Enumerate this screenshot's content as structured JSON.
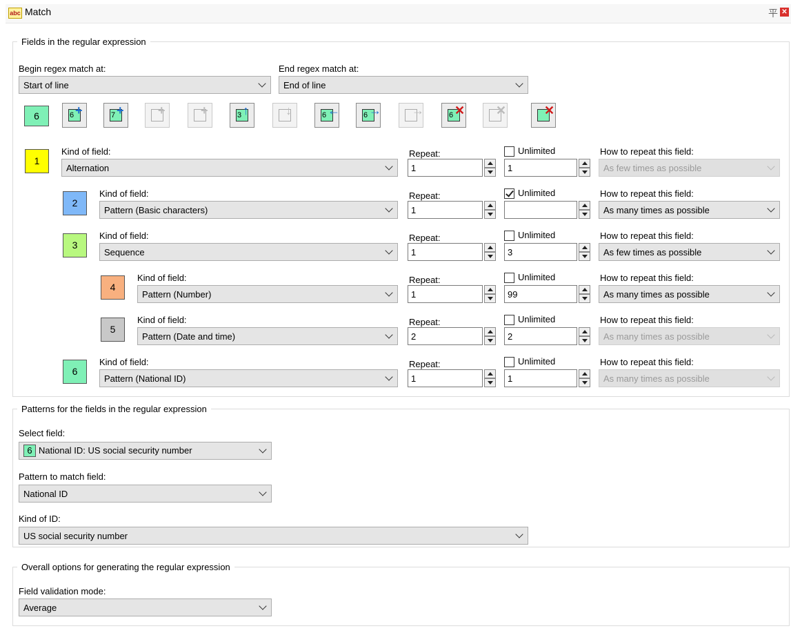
{
  "window": {
    "title": "Match",
    "title_icon_text": "abc"
  },
  "groups": {
    "fields": "Fields in the regular expression",
    "patterns": "Patterns for the fields in the regular expression",
    "overall": "Overall options for generating the regular expression"
  },
  "begin": {
    "label": "Begin regex match at:",
    "value": "Start of line"
  },
  "end": {
    "label": "End regex match at:",
    "value": "End of line"
  },
  "toolbar": {
    "counter": "6",
    "buttons": [
      {
        "name": "add-field-button",
        "num": "6",
        "enabled": true
      },
      {
        "name": "insert-field-button",
        "num": "7",
        "enabled": true
      },
      {
        "name": "add-child-button",
        "num": "",
        "enabled": false
      },
      {
        "name": "insert-child-button",
        "num": "",
        "enabled": false
      },
      {
        "name": "move-up-button",
        "num": "3",
        "enabled": true
      },
      {
        "name": "move-down-button",
        "num": "",
        "enabled": false
      },
      {
        "name": "move-left-button",
        "num": "6",
        "enabled": true
      },
      {
        "name": "move-right-button",
        "num": "6",
        "enabled": true
      },
      {
        "name": "move-in-button",
        "num": "",
        "enabled": false
      },
      {
        "name": "delete-field-button",
        "num": "6",
        "enabled": true
      },
      {
        "name": "delete-child-button",
        "num": "",
        "enabled": false
      },
      {
        "name": "delete-all-button",
        "num": "",
        "enabled": true
      }
    ]
  },
  "column_labels": {
    "kind": "Kind of field:",
    "repeat": "Repeat:",
    "unlimited": "Unlimited",
    "how": "How to repeat this field:"
  },
  "fields": [
    {
      "num": "1",
      "color": "#ffff00",
      "kind": "Alternation",
      "repeat": "1",
      "unlimited": false,
      "max": "1",
      "how": "As few times as possible",
      "how_enabled": false
    },
    {
      "num": "2",
      "color": "#7fb8f8",
      "kind": "Pattern (Basic characters)",
      "repeat": "1",
      "unlimited": true,
      "max": "",
      "how": "As many times as possible",
      "how_enabled": true
    },
    {
      "num": "3",
      "color": "#b8f87f",
      "kind": "Sequence",
      "repeat": "1",
      "unlimited": false,
      "max": "3",
      "how": "As few times as possible",
      "how_enabled": true
    },
    {
      "num": "4",
      "color": "#f8b07f",
      "kind": "Pattern (Number)",
      "repeat": "1",
      "unlimited": false,
      "max": "99",
      "how": "As many times as possible",
      "how_enabled": true
    },
    {
      "num": "5",
      "color": "#c8c8c8",
      "kind": "Pattern (Date and time)",
      "repeat": "2",
      "unlimited": false,
      "max": "2",
      "how": "As many times as possible",
      "how_enabled": false
    },
    {
      "num": "6",
      "color": "#7ff0b6",
      "kind": "Pattern (National ID)",
      "repeat": "1",
      "unlimited": false,
      "max": "1",
      "how": "As many times as possible",
      "how_enabled": false
    }
  ],
  "select_field": {
    "label": "Select field:",
    "badge": "6",
    "value": "National ID: US social security number"
  },
  "pattern_field": {
    "label": "Pattern to match field:",
    "value": "National ID"
  },
  "kind_of_id": {
    "label": "Kind of ID:",
    "value": "US social security number"
  },
  "validation": {
    "label": "Field validation mode:",
    "value": "Average"
  }
}
